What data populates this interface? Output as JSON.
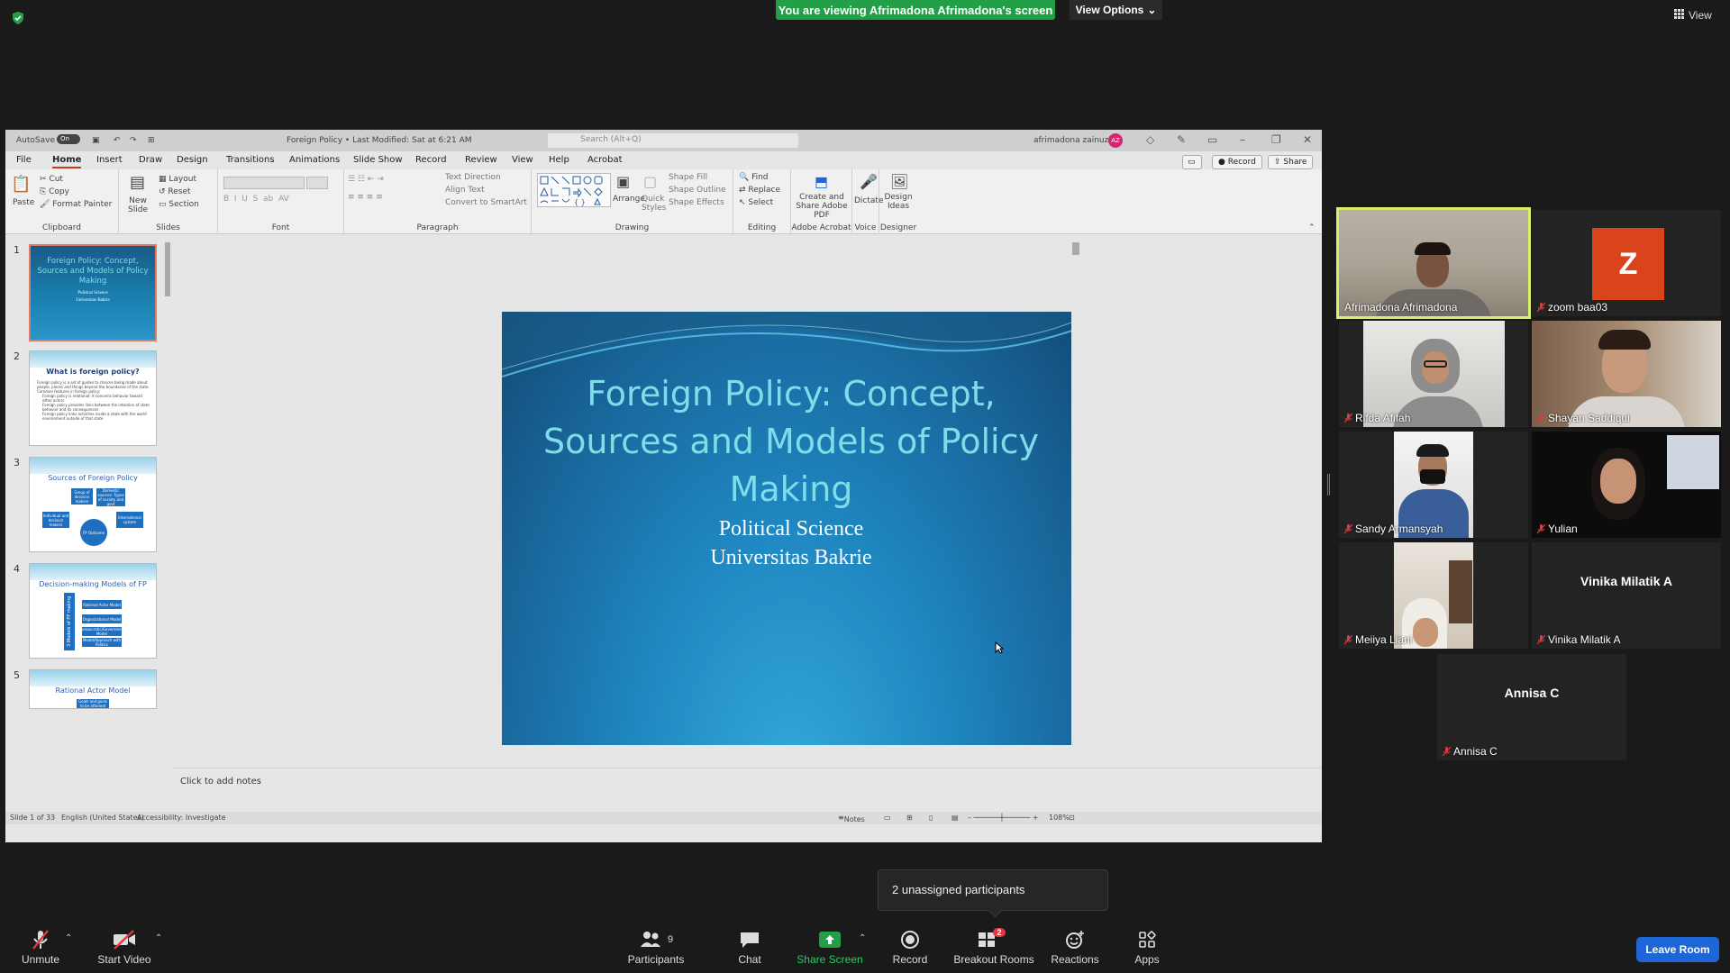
{
  "zoom": {
    "viewing_banner": "You are viewing Afrimadona Afrimadona's screen",
    "view_options": "View Options",
    "view_top": "View",
    "popup": "2 unassigned participants",
    "toolbar": {
      "unmute": "Unmute",
      "start_video": "Start Video",
      "participants": "Participants",
      "participants_count": "9",
      "chat": "Chat",
      "share_screen": "Share Screen",
      "record": "Record",
      "breakout_rooms": "Breakout Rooms",
      "breakout_badge": "2",
      "reactions": "Reactions",
      "apps": "Apps",
      "leave": "Leave Room"
    },
    "participants": [
      {
        "name": "Afrimadona Afrimadona",
        "video": true,
        "muted": false,
        "active": true
      },
      {
        "name": "zoom baa03",
        "video": false,
        "initial": "Z",
        "muted": true
      },
      {
        "name": "Rifda Afifah",
        "video": true,
        "muted": true
      },
      {
        "name": "Shayan Saddiqui",
        "video": true,
        "muted": true
      },
      {
        "name": "Sandy Armansyah",
        "video": true,
        "muted": true
      },
      {
        "name": "Yulian",
        "video": true,
        "muted": true
      },
      {
        "name": "Meiiya Liani",
        "video": true,
        "muted": true
      },
      {
        "name": "Vinika Milatik A",
        "video": false,
        "center": "Vinika Milatik A",
        "muted": true
      },
      {
        "name": "Annisa C",
        "video": false,
        "center": "Annisa C",
        "muted": true
      }
    ]
  },
  "ppt": {
    "autosave": "AutoSave",
    "autosave_state": "On",
    "doc_title": "Foreign Policy • Last Modified: Sat at 6:21 AM",
    "search": "Search (Alt+Q)",
    "user": "afrimadona zainuzir",
    "user_initials": "AZ",
    "tabs": [
      "File",
      "Home",
      "Insert",
      "Draw",
      "Design",
      "Transitions",
      "Animations",
      "Slide Show",
      "Record",
      "Review",
      "View",
      "Help",
      "Acrobat"
    ],
    "record_btn": "Record",
    "share_btn": "Share",
    "ribbon": {
      "clipboard": {
        "label": "Clipboard",
        "paste": "Paste",
        "cut": "Cut",
        "copy": "Copy",
        "format_painter": "Format Painter"
      },
      "slides": {
        "label": "Slides",
        "new_slide": "New Slide",
        "layout": "Layout",
        "reset": "Reset",
        "section": "Section"
      },
      "font": {
        "label": "Font"
      },
      "paragraph": {
        "label": "Paragraph",
        "text_direction": "Text Direction",
        "align_text": "Align Text",
        "smartart": "Convert to SmartArt"
      },
      "drawing": {
        "label": "Drawing",
        "arrange": "Arrange",
        "quick_styles": "Quick Styles",
        "shape_fill": "Shape Fill",
        "shape_outline": "Shape Outline",
        "shape_effects": "Shape Effects"
      },
      "editing": {
        "label": "Editing",
        "find": "Find",
        "replace": "Replace",
        "select": "Select"
      },
      "acrobat": {
        "label": "Adobe Acrobat",
        "create": "Create and Share Adobe PDF"
      },
      "voice": {
        "label": "Voice",
        "dictate": "Dictate"
      },
      "designer": {
        "label": "Designer",
        "ideas": "Design Ideas"
      }
    },
    "thumbs": [
      {
        "num": "1",
        "title": "Foreign Policy: Concept, Sources and Models of Policy Making",
        "sub1": "Political Science",
        "sub2": "Universitas Bakrie"
      },
      {
        "num": "2",
        "title": "What is foreign policy?",
        "bullets": [
          "Foreign policy is a set of guides to choices being made about people, places and things beyond the boundaries of the state.",
          "Common features in foreign policy:",
          "Foreign policy is relational: it concerns behavior toward other actors",
          "Foreign policy provides links between the intention of state behavior and its consequences",
          "Foreign policy links activities inside a state with the world environment outside of that state"
        ]
      },
      {
        "num": "3",
        "title": "Sources of Foreign Policy",
        "boxes": [
          "Group of decision makers",
          "Domestic sources: Types of society and govt",
          "Individual and decision makers",
          "International system",
          "FP Outcome"
        ]
      },
      {
        "num": "4",
        "title": "Decision-making Models of FP",
        "side": "3 Models of FP making",
        "boxes": [
          "Rational Actor Model",
          "Organizational Model",
          "Bureaucratic/Government Model",
          "Model/Approach with Politics"
        ]
      },
      {
        "num": "5",
        "title": "Rational Actor Model",
        "boxes": [
          "Goals and goals to be attained"
        ]
      }
    ],
    "slide": {
      "title": "Foreign Policy: Concept, Sources and Models of Policy Making",
      "subtitle1": "Political Science",
      "subtitle2": "Universitas Bakrie"
    },
    "notes_placeholder": "Click to add notes",
    "status": {
      "slide": "Slide 1 of 33",
      "lang": "English (United States)",
      "accessibility": "Accessibility: Investigate",
      "notes": "Notes",
      "zoom": "108%"
    }
  }
}
